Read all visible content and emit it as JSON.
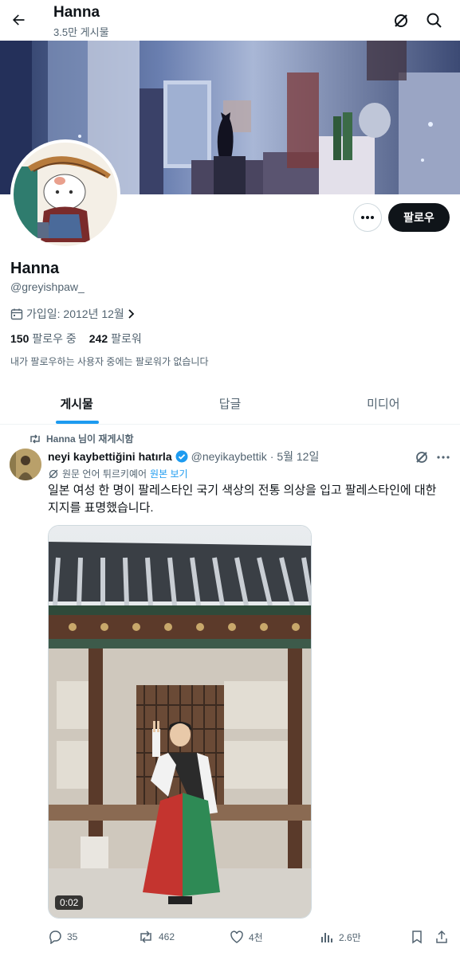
{
  "header": {
    "title": "Hanna",
    "post_count": "3.5만 게시물"
  },
  "profile": {
    "name": "Hanna",
    "handle": "@greyishpaw_",
    "joined": "가입일: 2012년 12월",
    "following_count": "150",
    "following_label": "팔로우 중",
    "followers_count": "242",
    "followers_label": "팔로워",
    "mutual_note": "내가 팔로우하는 사용자 중에는 팔로워가 없습니다",
    "follow_button": "팔로우"
  },
  "tabs": [
    {
      "label": "게시물",
      "active": true
    },
    {
      "label": "답글",
      "active": false
    },
    {
      "label": "미디어",
      "active": false
    }
  ],
  "post": {
    "repost_label": "Hanna 님이 재게시함",
    "author_name": "neyi kaybettiğini hatırla",
    "author_handle": "@neyikaybettik",
    "date": "· 5월 12일",
    "translate_prefix": "원문 언어 튀르키예어",
    "translate_link": "원본 보기",
    "text": "일본 여성 한 명이 팔레스타인 국기 색상의 전통 의상을 입고 팔레스타인에 대한 지지를 표명했습니다.",
    "video_time": "0:02",
    "replies": "35",
    "reposts": "462",
    "likes": "4천",
    "views": "2.6만"
  },
  "colors": {
    "accent": "#1d9bf0",
    "text_primary": "#0f1419",
    "text_secondary": "#536471",
    "verified": "#1d9bf0"
  },
  "icons": [
    "back-arrow-icon",
    "grok-icon",
    "search-icon",
    "more-icon",
    "calendar-icon",
    "chevron-right-icon",
    "repost-icon",
    "verified-badge-icon",
    "translate-icon",
    "reply-icon",
    "like-icon",
    "views-icon",
    "bookmark-icon",
    "share-icon"
  ]
}
